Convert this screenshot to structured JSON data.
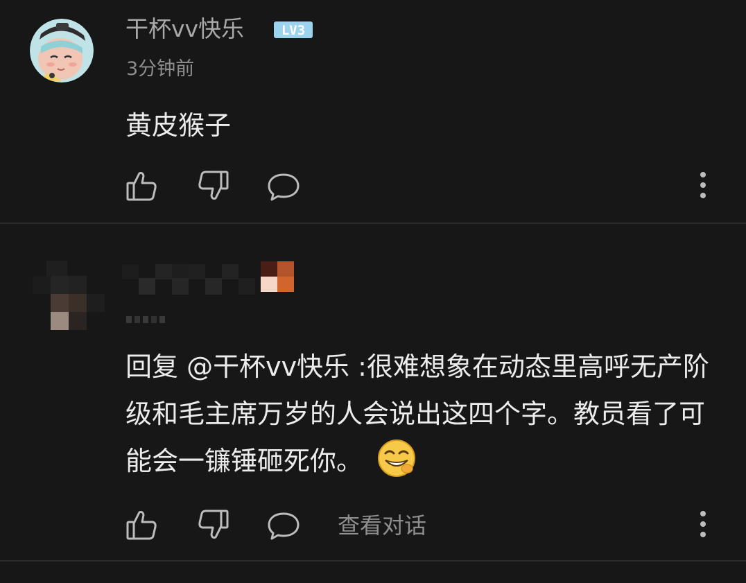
{
  "comments": [
    {
      "username": "干杯vv快乐",
      "level": "LV3",
      "time": "3分钟前",
      "content": "黄皮猴子",
      "icons": [
        "like-icon",
        "dislike-icon",
        "reply-icon",
        "more-icon"
      ]
    },
    {
      "username": "",
      "time": "",
      "content": "回复 @干杯vv快乐 :很难想象在动态里高呼无产阶级和毛主席万岁的人会说出这四个字。教员看了可能会一镰锤砸死你。",
      "view_conversation": "查看对话",
      "icons": [
        "like-icon",
        "dislike-icon",
        "reply-icon",
        "more-icon"
      ]
    }
  ],
  "colors": {
    "background": "#171717",
    "divider": "#2b2b2b",
    "primary_text": "#ececec",
    "secondary_text": "#a9a9a9",
    "muted_text": "#8e8e8e",
    "level_badge": "#9bd4ee"
  }
}
